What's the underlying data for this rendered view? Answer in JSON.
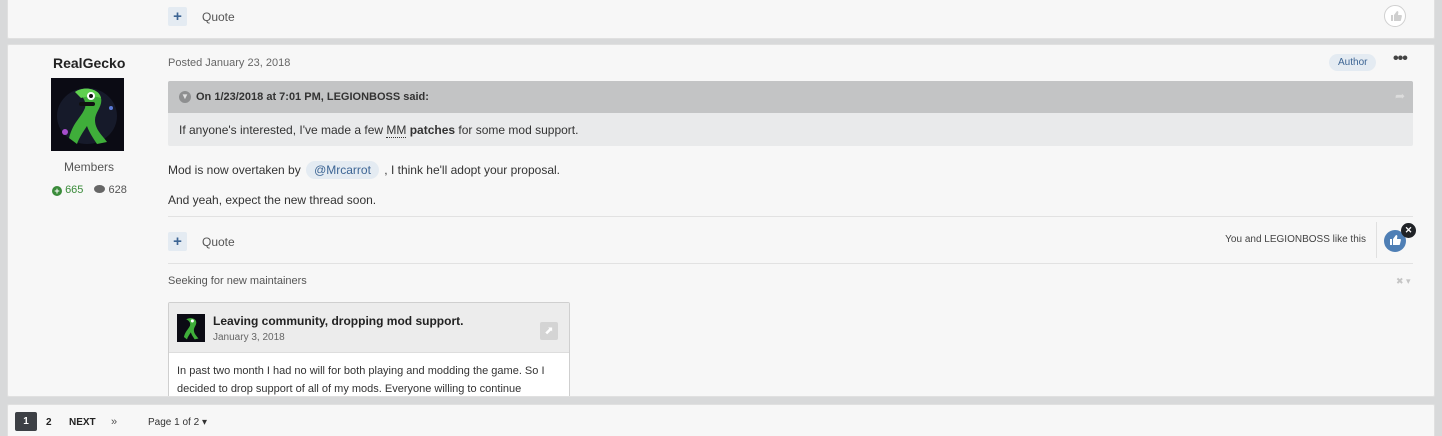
{
  "previous_post": {
    "quote_label": "Quote",
    "plus_icon": "+"
  },
  "post": {
    "author": {
      "name": "RealGecko",
      "group": "Members",
      "reputation": "665",
      "post_count": "628"
    },
    "date": "Posted January 23, 2018",
    "author_badge": "Author",
    "menu_icon": "•••",
    "quote": {
      "cite": "On 1/23/2018 at 7:01 PM, LEGIONBOSS said:",
      "text_before": "If anyone's interested, I've made a few ",
      "abbr": "MM",
      "link": "patches",
      "text_after": " for some mod support."
    },
    "body": {
      "p1_before": "Mod is now overtaken by ",
      "mention": "@Mrcarrot",
      "p1_after": " , I think he'll adopt your proposal.",
      "p2": "And yeah, expect the new thread soon."
    },
    "quote_label": "Quote",
    "likes_text": "You and LEGIONBOSS like this",
    "signature": "Seeking for new maintainers",
    "embed": {
      "title": "Leaving community, dropping mod support.",
      "date": "January 3, 2018",
      "excerpt": "In past two month I had no will for both playing and modding the game. So I decided to drop support of all of my mods. Everyone willing to continue"
    }
  },
  "pagination": {
    "current": "1",
    "page2": "2",
    "next": "NEXT",
    "last": "»",
    "page_of": "Page 1 of 2"
  },
  "colors": {
    "accent": "#3d6594",
    "reputation": "#3a8b3a",
    "react": "#4f7fb5"
  }
}
